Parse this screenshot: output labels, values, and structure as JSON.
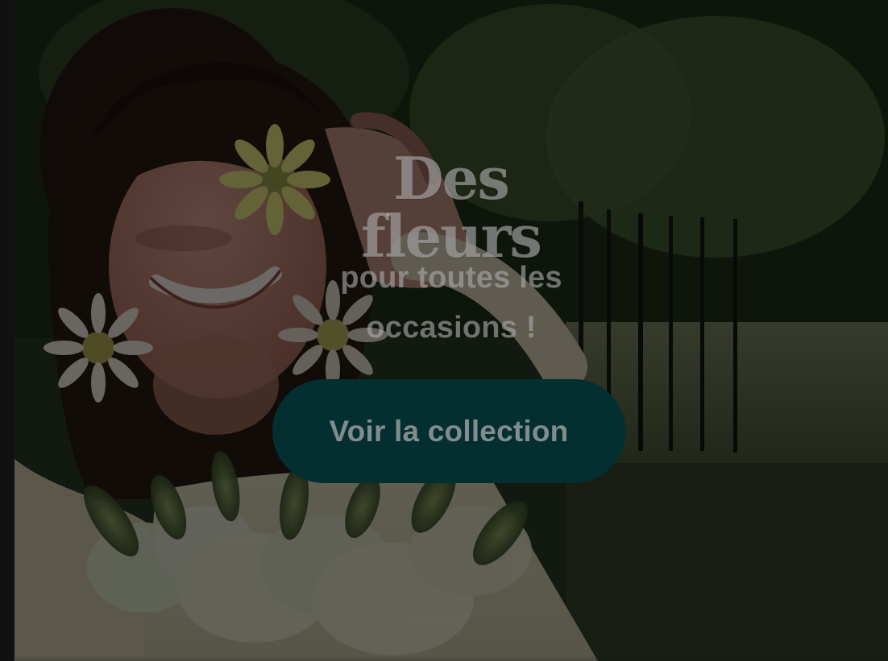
{
  "hero": {
    "title": "Des fleurs",
    "subtitle": "pour toutes les occasions !",
    "cta_label": "Voir la collection"
  },
  "colors": {
    "overlay": "#000000",
    "cta_background": "#032f31",
    "text": "#aaaaaa"
  },
  "icons": {
    "hero_image": "woman-with-flowers-photo"
  }
}
